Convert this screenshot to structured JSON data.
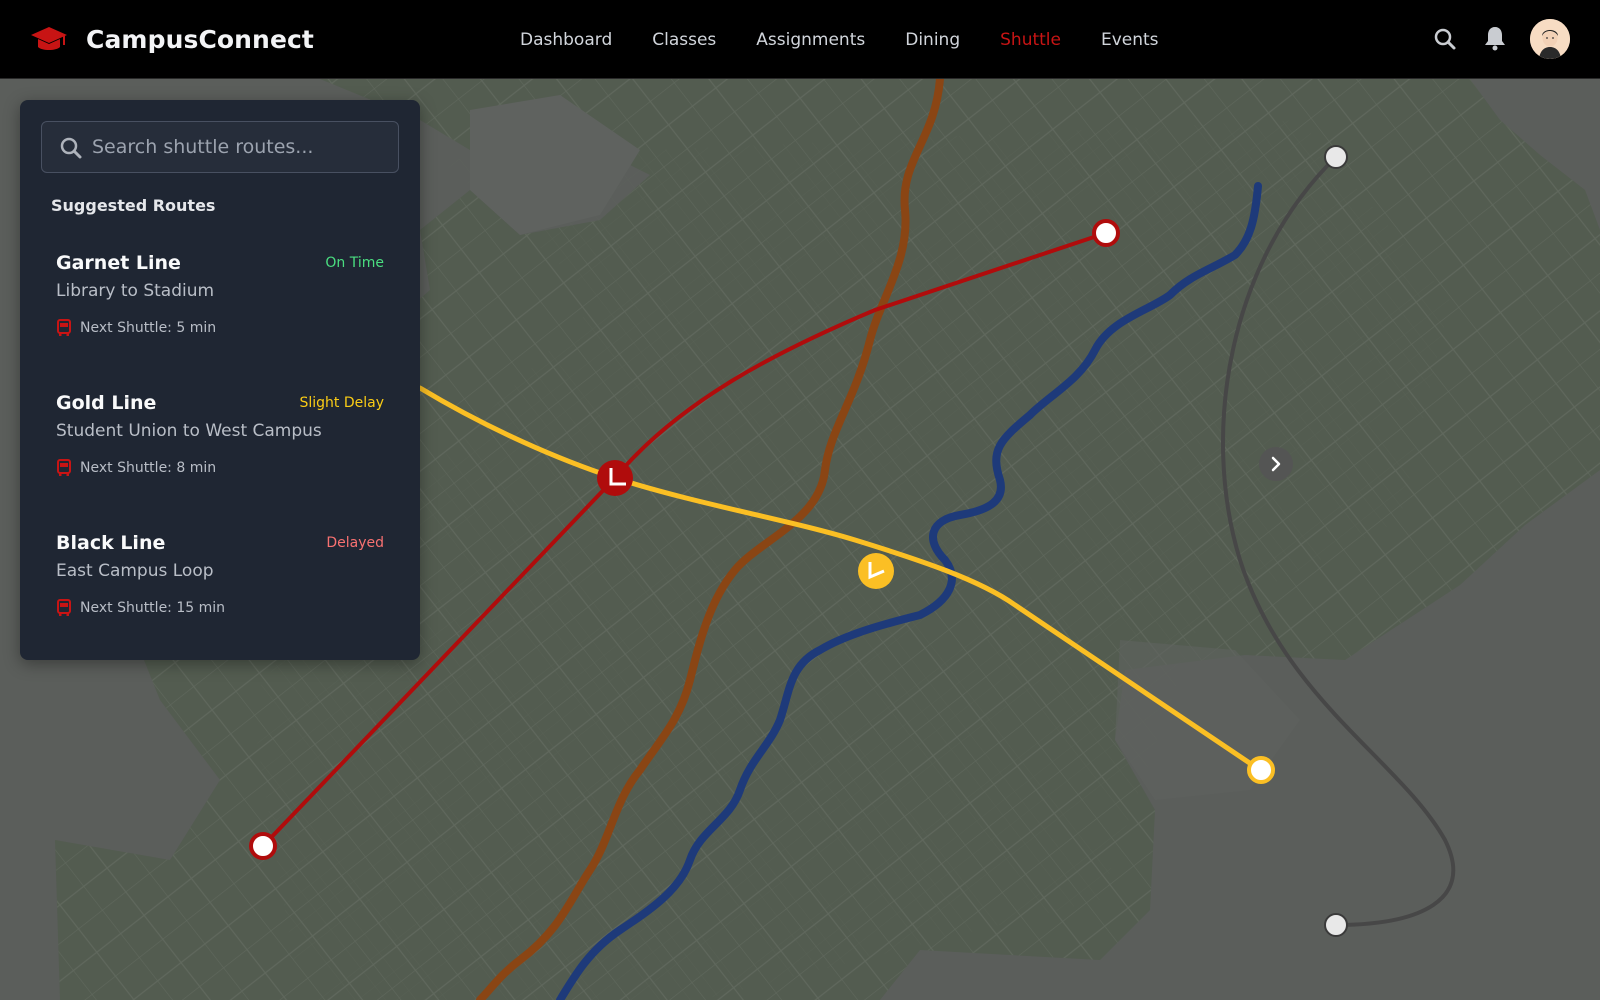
{
  "app": {
    "title": "CampusConnect"
  },
  "nav": {
    "items": [
      {
        "label": "Dashboard",
        "active": false
      },
      {
        "label": "Classes",
        "active": false
      },
      {
        "label": "Assignments",
        "active": false
      },
      {
        "label": "Dining",
        "active": false
      },
      {
        "label": "Shuttle",
        "active": true
      },
      {
        "label": "Events",
        "active": false
      }
    ]
  },
  "header_icons": [
    "search-icon",
    "bell-icon",
    "avatar"
  ],
  "search": {
    "placeholder": "Search shuttle routes...",
    "value": ""
  },
  "panel": {
    "section_title": "Suggested Routes",
    "routes": [
      {
        "name": "Garnet Line",
        "status": "On Time",
        "status_color": "#4ade80",
        "description": "Library to Stadium",
        "next": "Next Shuttle: 5 min",
        "color": "#b00c0c"
      },
      {
        "name": "Gold Line",
        "status": "Slight Delay",
        "status_color": "#facc15",
        "description": "Student Union to West Campus",
        "next": "Next Shuttle: 8 min",
        "color": "#fbbf24"
      },
      {
        "name": "Black Line",
        "status": "Delayed",
        "status_color": "#f87171",
        "description": "East Campus Loop",
        "next": "Next Shuttle: 15 min",
        "color": "#4a4a4a"
      }
    ]
  },
  "colors": {
    "accent": "#c81414",
    "header_bg": "#000000",
    "panel_bg": "#1f2633",
    "map_land": "#535c50",
    "map_bg": "#5b5e5b",
    "garnet": "#b00c0c",
    "gold": "#fbbf24",
    "black_line": "#4a4a4a",
    "river_blue": "#1e3a7a",
    "river_orange": "#9a4a12"
  }
}
